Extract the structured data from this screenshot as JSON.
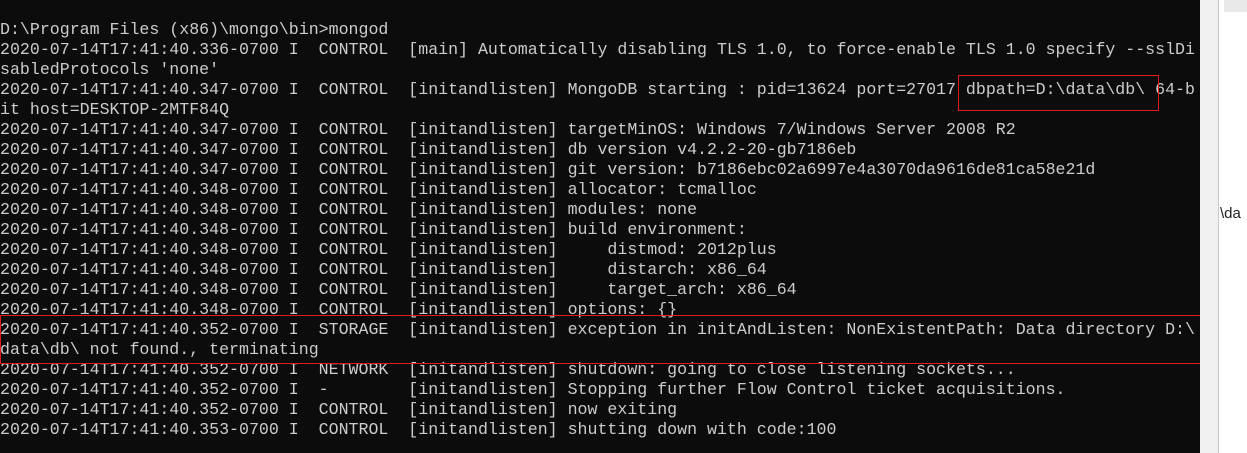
{
  "console": {
    "lines": [
      "D:\\Program Files (x86)\\mongo\\bin>mongod",
      "2020-07-14T17:41:40.336-0700 I  CONTROL  [main] Automatically disabling TLS 1.0, to force-enable TLS 1.0 specify --sslDi",
      "sabledProtocols 'none'",
      "2020-07-14T17:41:40.347-0700 I  CONTROL  [initandlisten] MongoDB starting : pid=13624 port=27017 dbpath=D:\\data\\db\\ 64-b",
      "it host=DESKTOP-2MTF84Q",
      "2020-07-14T17:41:40.347-0700 I  CONTROL  [initandlisten] targetMinOS: Windows 7/Windows Server 2008 R2",
      "2020-07-14T17:41:40.347-0700 I  CONTROL  [initandlisten] db version v4.2.2-20-gb7186eb",
      "2020-07-14T17:41:40.347-0700 I  CONTROL  [initandlisten] git version: b7186ebc02a6997e4a3070da9616de81ca58e21d",
      "2020-07-14T17:41:40.348-0700 I  CONTROL  [initandlisten] allocator: tcmalloc",
      "2020-07-14T17:41:40.348-0700 I  CONTROL  [initandlisten] modules: none",
      "2020-07-14T17:41:40.348-0700 I  CONTROL  [initandlisten] build environment:",
      "2020-07-14T17:41:40.348-0700 I  CONTROL  [initandlisten]     distmod: 2012plus",
      "2020-07-14T17:41:40.348-0700 I  CONTROL  [initandlisten]     distarch: x86_64",
      "2020-07-14T17:41:40.348-0700 I  CONTROL  [initandlisten]     target_arch: x86_64",
      "2020-07-14T17:41:40.348-0700 I  CONTROL  [initandlisten] options: {}",
      "2020-07-14T17:41:40.352-0700 I  STORAGE  [initandlisten] exception in initAndListen: NonExistentPath: Data directory D:\\",
      "data\\db\\ not found., terminating",
      "2020-07-14T17:41:40.352-0700 I  NETWORK  [initandlisten] shutdown: going to close listening sockets...",
      "2020-07-14T17:41:40.352-0700 I  -        [initandlisten] Stopping further Flow Control ticket acquisitions.",
      "2020-07-14T17:41:40.352-0700 I  CONTROL  [initandlisten] now exiting",
      "2020-07-14T17:41:40.353-0700 I  CONTROL  [initandlisten] shutting down with code:100"
    ]
  },
  "background_window": {
    "partial_text": "\\da"
  },
  "colors": {
    "console_bg": "#0c0c0c",
    "console_text": "#cccccc",
    "highlight": "#e01b1b",
    "scrollbar": "#f0f0f0"
  }
}
